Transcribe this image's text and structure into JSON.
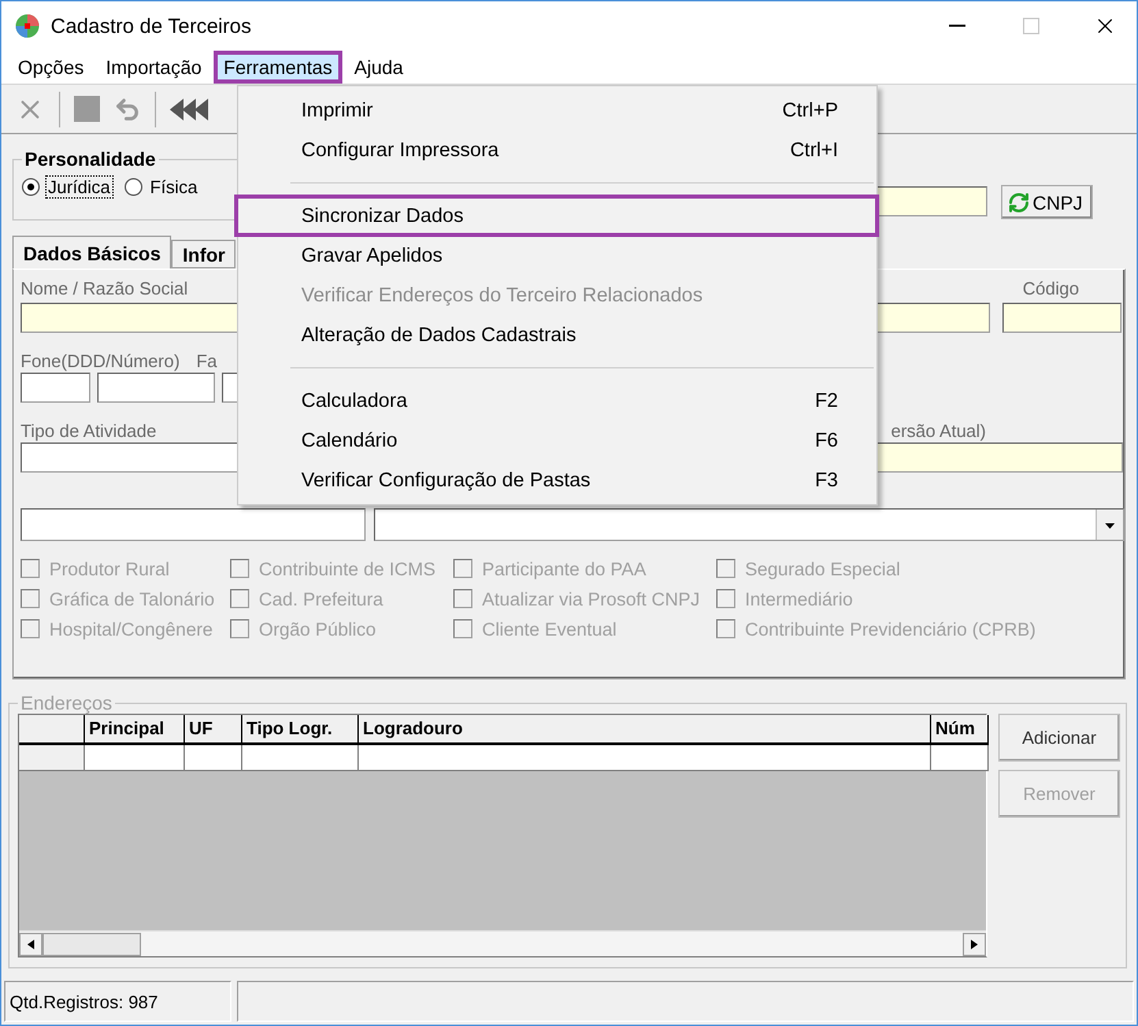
{
  "window": {
    "title": "Cadastro de Terceiros"
  },
  "menu_bar": [
    {
      "label": "Opções",
      "selected": false,
      "outlined": false
    },
    {
      "label": "Importação",
      "selected": false,
      "outlined": false
    },
    {
      "label": "Ferramentas",
      "selected": true,
      "outlined": true
    },
    {
      "label": "Ajuda",
      "selected": false,
      "outlined": false
    }
  ],
  "menu": {
    "items": [
      {
        "kind": "item",
        "label": "Imprimir",
        "shortcut": "Ctrl+P",
        "disabled": false,
        "outlined": false
      },
      {
        "kind": "item",
        "label": "Configurar Impressora",
        "shortcut": "Ctrl+I",
        "disabled": false,
        "outlined": false
      },
      {
        "kind": "separator"
      },
      {
        "kind": "item",
        "label": "Sincronizar Dados",
        "disabled": false,
        "outlined": true
      },
      {
        "kind": "item",
        "label": "Gravar Apelidos",
        "disabled": false,
        "outlined": false
      },
      {
        "kind": "item",
        "label": "Verificar Endereços do Terceiro Relacionados",
        "disabled": true,
        "outlined": false
      },
      {
        "kind": "item",
        "label": "Alteração de Dados Cadastrais",
        "disabled": false,
        "outlined": false
      },
      {
        "kind": "separator"
      },
      {
        "kind": "item",
        "label": "Calculadora",
        "shortcut": "F2",
        "disabled": false,
        "outlined": false
      },
      {
        "kind": "item",
        "label": "Calendário",
        "shortcut": "F6",
        "disabled": false,
        "outlined": false
      },
      {
        "kind": "item",
        "label": "Verificar Configuração de Pastas",
        "shortcut": "F3",
        "disabled": false,
        "outlined": false
      }
    ]
  },
  "personalidade": {
    "title": "Personalidade",
    "options": [
      {
        "label": "Jurídica",
        "selected": true
      },
      {
        "label": "Física",
        "selected": false
      }
    ]
  },
  "cnpj_button": {
    "label": "CNPJ"
  },
  "tabs": [
    {
      "label": "Dados Básicos",
      "selected": true
    },
    {
      "label": "Infor",
      "selected": false
    }
  ],
  "form": {
    "name_label": "Nome / Razão Social",
    "code_label": "Código",
    "phone_label": "Fone(DDD/Número)",
    "fax_label": "Fa",
    "activity_label": "Tipo de Atividade",
    "version_label": "ersão Atual)"
  },
  "checkbox_columns": [
    [
      {
        "label": "Produtor Rural",
        "checked": false,
        "disabled": true
      },
      {
        "label": "Gráfica de Talonário",
        "checked": false,
        "disabled": true
      },
      {
        "label": "Hospital/Congênere",
        "checked": false,
        "disabled": true
      }
    ],
    [
      {
        "label": "Contribuinte de ICMS",
        "checked": false,
        "disabled": true
      },
      {
        "label": "Cad. Prefeitura",
        "checked": false,
        "disabled": true
      },
      {
        "label": "Orgão Público",
        "checked": false,
        "disabled": true
      }
    ],
    [
      {
        "label": "Participante do PAA",
        "checked": false,
        "disabled": true
      },
      {
        "label": "Atualizar via Prosoft CNPJ",
        "checked": false,
        "disabled": true
      },
      {
        "label": "Cliente Eventual",
        "checked": false,
        "disabled": true
      }
    ],
    [
      {
        "label": "Segurado Especial",
        "checked": false,
        "disabled": true
      },
      {
        "label": "Intermediário",
        "checked": false,
        "disabled": true
      },
      {
        "label": "Contribuinte Previdenciário (CPRB)",
        "checked": false,
        "disabled": true
      }
    ]
  ],
  "enderecos": {
    "title": "Endereços",
    "columns": [
      "Principal",
      "UF",
      "Tipo Logr.",
      "Logradouro",
      "Núm"
    ],
    "buttons": [
      {
        "label": "Adicionar",
        "disabled": false
      },
      {
        "label": "Remover",
        "disabled": true
      }
    ]
  },
  "status_bar": {
    "records": "Qtd.Registros: 987"
  }
}
